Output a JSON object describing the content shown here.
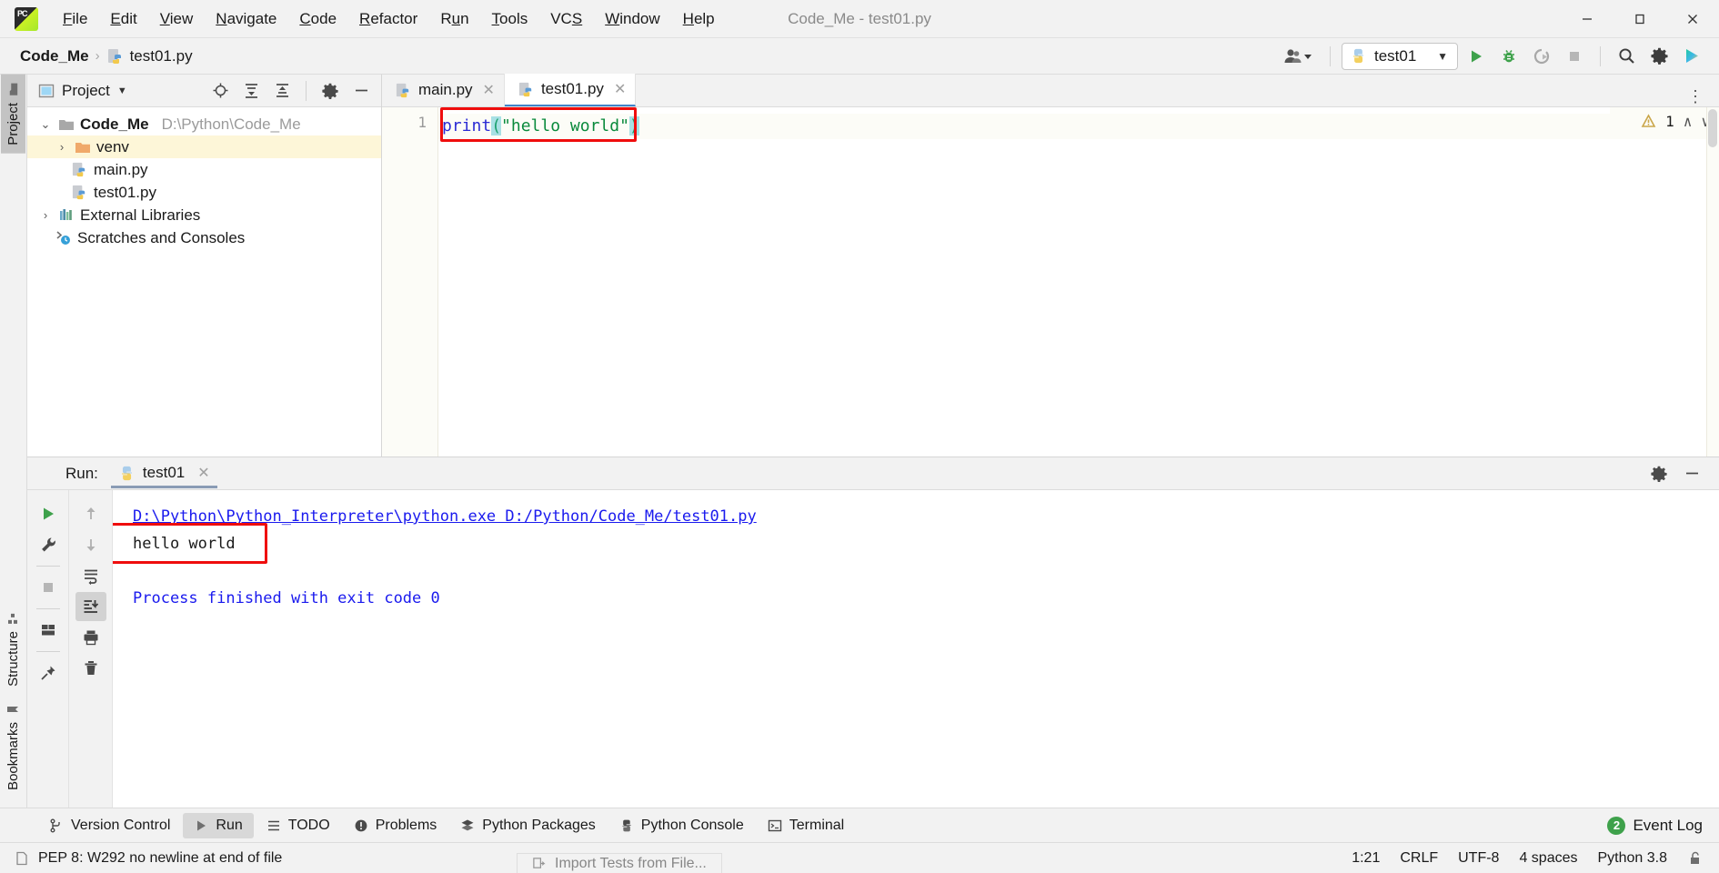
{
  "window": {
    "title": "Code_Me - test01.py",
    "minimize_label": "–",
    "maximize_label": "❐",
    "close_label": "✕",
    "logo_text": "PC"
  },
  "menubar": {
    "items": [
      {
        "label": "File",
        "mnemonic": "F"
      },
      {
        "label": "Edit",
        "mnemonic": "E"
      },
      {
        "label": "View",
        "mnemonic": "V"
      },
      {
        "label": "Navigate",
        "mnemonic": "N"
      },
      {
        "label": "Code",
        "mnemonic": "C"
      },
      {
        "label": "Refactor",
        "mnemonic": "R"
      },
      {
        "label": "Run",
        "mnemonic": "u"
      },
      {
        "label": "Tools",
        "mnemonic": "T"
      },
      {
        "label": "VCS",
        "mnemonic": "S"
      },
      {
        "label": "Window",
        "mnemonic": "W"
      },
      {
        "label": "Help",
        "mnemonic": "H"
      }
    ]
  },
  "navbar": {
    "breadcrumb_project": "Code_Me",
    "breadcrumb_sep": "›",
    "breadcrumb_file": "test01.py",
    "run_config": "test01",
    "run_config_caret": "▼",
    "account_caret": "▼",
    "buttons": [
      {
        "name": "run-button",
        "label": "Run"
      },
      {
        "name": "debug-button",
        "label": "Debug"
      },
      {
        "name": "coverage-button",
        "label": "Run with Coverage"
      },
      {
        "name": "stop-button",
        "label": "Stop"
      },
      {
        "name": "search-everywhere-button",
        "label": "Search Everywhere"
      },
      {
        "name": "settings-button",
        "label": "Settings"
      },
      {
        "name": "updates-button",
        "label": "Updates"
      }
    ]
  },
  "sidebar_left": {
    "tabs": [
      {
        "label": "Project",
        "icon": "folder-icon",
        "active": true
      },
      {
        "label": "Structure",
        "icon": "structure-icon",
        "active": false
      },
      {
        "label": "Bookmarks",
        "icon": "bookmark-icon",
        "active": false
      }
    ]
  },
  "project_panel": {
    "title": "Project",
    "title_caret": "▼",
    "tools": [
      {
        "name": "select-opened-file-icon",
        "label": "Select Opened File"
      },
      {
        "name": "expand-all-icon",
        "label": "Expand All"
      },
      {
        "name": "collapse-all-icon",
        "label": "Collapse All"
      },
      {
        "name": "gear-icon",
        "label": "Options"
      },
      {
        "name": "hide-icon",
        "label": "Hide"
      }
    ],
    "tree": [
      {
        "label": "Code_Me",
        "path": "D:\\Python\\Code_Me",
        "icon": "folder-icon",
        "arrow": "⌄",
        "indent": 1,
        "bold": true,
        "selected": false
      },
      {
        "label": "venv",
        "path": "",
        "icon": "venv-folder-icon",
        "arrow": "›",
        "indent": 2,
        "bold": false,
        "selected": true
      },
      {
        "label": "main.py",
        "path": "",
        "icon": "python-file-icon",
        "arrow": "",
        "indent": 3,
        "bold": false,
        "selected": false
      },
      {
        "label": "test01.py",
        "path": "",
        "icon": "python-file-icon",
        "arrow": "",
        "indent": 3,
        "bold": false,
        "selected": false
      },
      {
        "label": "External Libraries",
        "path": "",
        "icon": "libraries-icon",
        "arrow": "›",
        "indent": 1,
        "bold": false,
        "selected": false
      },
      {
        "label": "Scratches and Consoles",
        "path": "",
        "icon": "scratches-icon",
        "arrow": "",
        "indent": 2,
        "bold": false,
        "selected": false
      }
    ]
  },
  "editor": {
    "tabs": [
      {
        "label": "main.py",
        "active": false,
        "close": "✕"
      },
      {
        "label": "test01.py",
        "active": true,
        "close": "✕"
      }
    ],
    "kebab": "⋮",
    "line_number": "1",
    "code": {
      "func": "print",
      "open_paren": "(",
      "string": "\"hello world\"",
      "close_paren": ")"
    },
    "inspection_count": "1",
    "inspection_icon": "warning-triangle-icon",
    "nav_up": "∧",
    "nav_down": "∨"
  },
  "run_panel": {
    "label": "Run:",
    "tab_label": "test01",
    "tab_close": "✕",
    "header_tools": [
      {
        "name": "gear-icon",
        "label": "Settings"
      },
      {
        "name": "hide-icon",
        "label": "Hide"
      }
    ],
    "left_tools": [
      {
        "name": "rerun-icon",
        "label": "Rerun"
      },
      {
        "name": "wrench-icon",
        "label": "Modify Run Configuration"
      },
      {
        "name": "stop-icon",
        "label": "Stop"
      },
      {
        "name": "layout-icon",
        "label": "Layout Settings"
      },
      {
        "name": "pin-icon",
        "label": "Pin Tab"
      }
    ],
    "right_tools": [
      {
        "name": "arrow-up-icon",
        "label": "Up the Stack Trace"
      },
      {
        "name": "arrow-down-icon",
        "label": "Down the Stack Trace"
      },
      {
        "name": "soft-wrap-icon",
        "label": "Soft-Wrap"
      },
      {
        "name": "scroll-to-end-icon",
        "label": "Scroll to End"
      },
      {
        "name": "print-icon",
        "label": "Print"
      },
      {
        "name": "trash-icon",
        "label": "Clear All"
      }
    ],
    "console": [
      {
        "text": "D:\\Python\\Python_Interpreter\\python.exe D:/Python/Code_Me/test01.py",
        "style": "path"
      },
      {
        "text": "hello world",
        "style": "output"
      },
      {
        "text": "",
        "style": "blank"
      },
      {
        "text": "Process finished with exit code 0",
        "style": "done"
      }
    ]
  },
  "tool_window_bar": {
    "items": [
      {
        "label": "Version Control",
        "icon": "branch-icon",
        "active": false
      },
      {
        "label": "Run",
        "icon": "play-icon",
        "active": true
      },
      {
        "label": "TODO",
        "icon": "list-icon",
        "active": false
      },
      {
        "label": "Problems",
        "icon": "problems-icon",
        "active": false
      },
      {
        "label": "Python Packages",
        "icon": "packages-icon",
        "active": false
      },
      {
        "label": "Python Console",
        "icon": "python-icon",
        "active": false
      },
      {
        "label": "Terminal",
        "icon": "terminal-icon",
        "active": false
      }
    ],
    "event_log_label": "Event Log",
    "event_log_count": "2"
  },
  "statusbar": {
    "message": "PEP 8: W292 no newline at end of file",
    "message_icon": "note-icon",
    "caret_position": "1:21",
    "line_separator": "CRLF",
    "encoding": "UTF-8",
    "indent": "4 spaces",
    "interpreter": "Python 3.8",
    "lock_icon": "unlocked-icon"
  },
  "popup_peek": {
    "label": "Import Tests from File...",
    "icon": "import-icon"
  },
  "colors": {
    "accent_blue": "#4083c9",
    "highlight_red": "#ef0d0d",
    "tree_selection": "#fdf6d8",
    "green_run": "#3ea14b",
    "link_blue": "#1a1aee",
    "string_green": "#0a8a3c",
    "keyword_blue": "#2b2bd4",
    "bracket_cyan": "#a8e0e4"
  }
}
